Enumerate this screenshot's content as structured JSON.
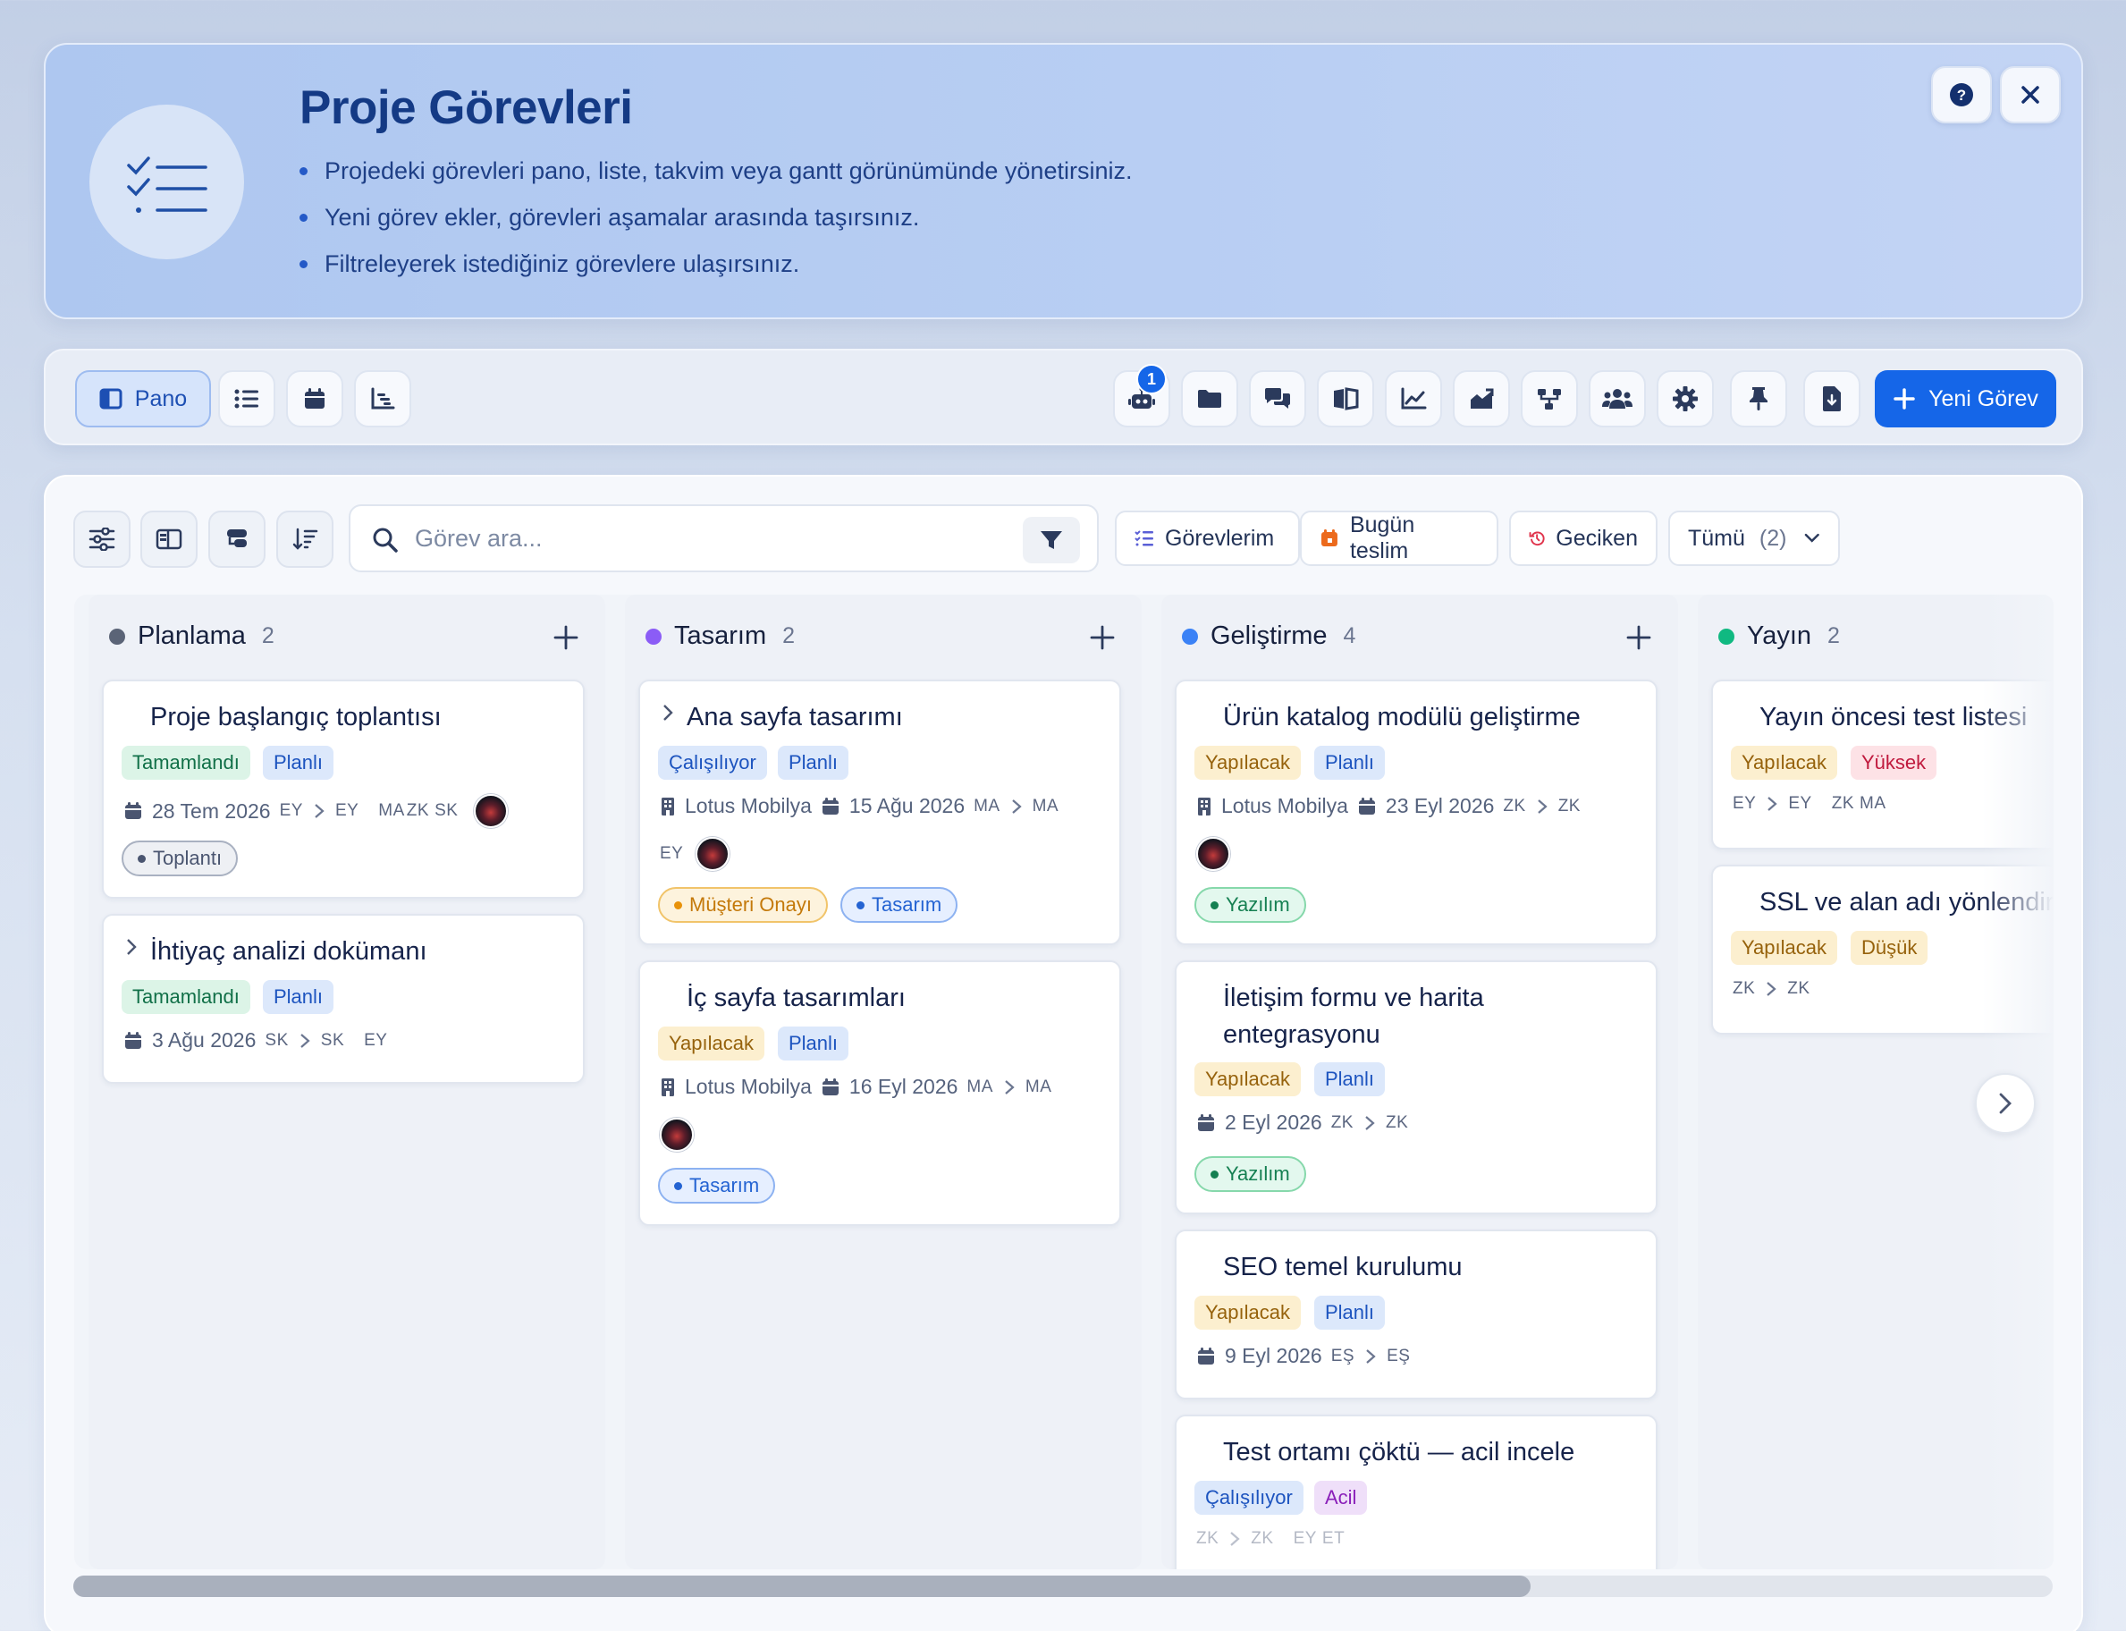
{
  "header": {
    "title": "Proje Görevleri",
    "bullets": [
      "Projedeki görevleri pano, liste, takvim veya gantt görünümünde yönetirsiniz.",
      "Yeni görev ekler, görevleri aşamalar arasında taşırsınız.",
      "Filtreleyerek istediğiniz görevlere ulaşırsınız."
    ],
    "icon": "task-checklist-icon"
  },
  "toolbar": {
    "views": [
      {
        "label": "Pano",
        "icon": "board-icon",
        "active": true
      },
      {
        "icon": "list-icon"
      },
      {
        "icon": "calendar-icon"
      },
      {
        "icon": "gantt-icon"
      }
    ],
    "robot_badge": "1",
    "actions": [
      "robot-icon",
      "folder-icon",
      "chat-icon",
      "book-icon",
      "chart-line-icon",
      "chart-area-icon",
      "workflow-icon",
      "team-icon",
      "gear-icon",
      "pin-icon",
      "export-icon"
    ],
    "new_task_label": "Yeni Görev",
    "accent": "#1566e8"
  },
  "filters": {
    "search_placeholder": "Görev ara...",
    "my_tasks": "Görevlerim",
    "due_today": "Bugün teslim",
    "overdue": "Geciken",
    "all_label": "Tümü",
    "all_count": "(2)"
  },
  "columns": [
    {
      "name": "Planlama",
      "count": "2",
      "color": "#5b6477",
      "cards": [
        {
          "title": "Proje başlangıç toplantısı",
          "status": "Tamamlandı",
          "plan": "Planlı",
          "date": "28 Tem 2026",
          "from": "EY",
          "to": "EY",
          "assignees": [
            "MA",
            "ZK",
            "SK"
          ],
          "label": "Toplantı"
        },
        {
          "title": "İhtiyaç analizi dokümanı",
          "status": "Tamamlandı",
          "plan": "Planlı",
          "date": "3 Ağu 2026",
          "from": "SK",
          "to": "SK",
          "assignees": [
            "EY"
          ]
        }
      ]
    },
    {
      "name": "Tasarım",
      "count": "2",
      "color": "#8b5cf6",
      "cards": [
        {
          "title": "Ana sayfa tasarımı",
          "status": "Çalışılıyor",
          "plan": "Planlı",
          "company": "Lotus Mobilya",
          "date": "15 Ağu 2026",
          "from": "MA",
          "to": "MA",
          "assignees": [
            "EY"
          ],
          "labels": [
            "Müşteri Onayı",
            "Tasarım"
          ]
        },
        {
          "title": "İç sayfa tasarımları",
          "status": "Yapılacak",
          "plan": "Planlı",
          "company": "Lotus Mobilya",
          "date": "16 Eyl 2026",
          "from": "MA",
          "to": "MA",
          "label": "Tasarım"
        }
      ]
    },
    {
      "name": "Geliştirme",
      "count": "4",
      "color": "#3b82f6",
      "cards": [
        {
          "title": "Ürün katalog modülü geliştirme",
          "status": "Yapılacak",
          "plan": "Planlı",
          "company": "Lotus Mobilya",
          "date": "23 Eyl 2026",
          "from": "ZK",
          "to": "ZK",
          "label": "Yazılım"
        },
        {
          "title": "İletişim formu ve harita entegrasyonu",
          "status": "Yapılacak",
          "plan": "Planlı",
          "date": "2 Eyl 2026",
          "from": "ZK",
          "to": "ZK",
          "label": "Yazılım"
        },
        {
          "title": "SEO temel kurulumu",
          "status": "Yapılacak",
          "plan": "Planlı",
          "date": "9 Eyl 2026",
          "from": "EŞ",
          "to": "EŞ"
        },
        {
          "title": "Test ortamı çöktü — acil incele",
          "status": "Çalışılıyor",
          "priority": "Acil",
          "from": "ZK",
          "to": "ZK",
          "assignees": [
            "EY",
            "ET"
          ]
        }
      ]
    },
    {
      "name": "Yayın",
      "count": "2",
      "color": "#10b981",
      "cards": [
        {
          "title": "Yayın öncesi test listesi",
          "status": "Yapılacak",
          "priority": "Yüksek",
          "from": "EY",
          "to": "EY",
          "assignees": [
            "ZK",
            "MA"
          ]
        },
        {
          "title": "SSL ve alan adı yönlendirme",
          "status": "Yapılacak",
          "priority": "Düşük",
          "from": "ZK",
          "to": "ZK"
        }
      ]
    }
  ]
}
